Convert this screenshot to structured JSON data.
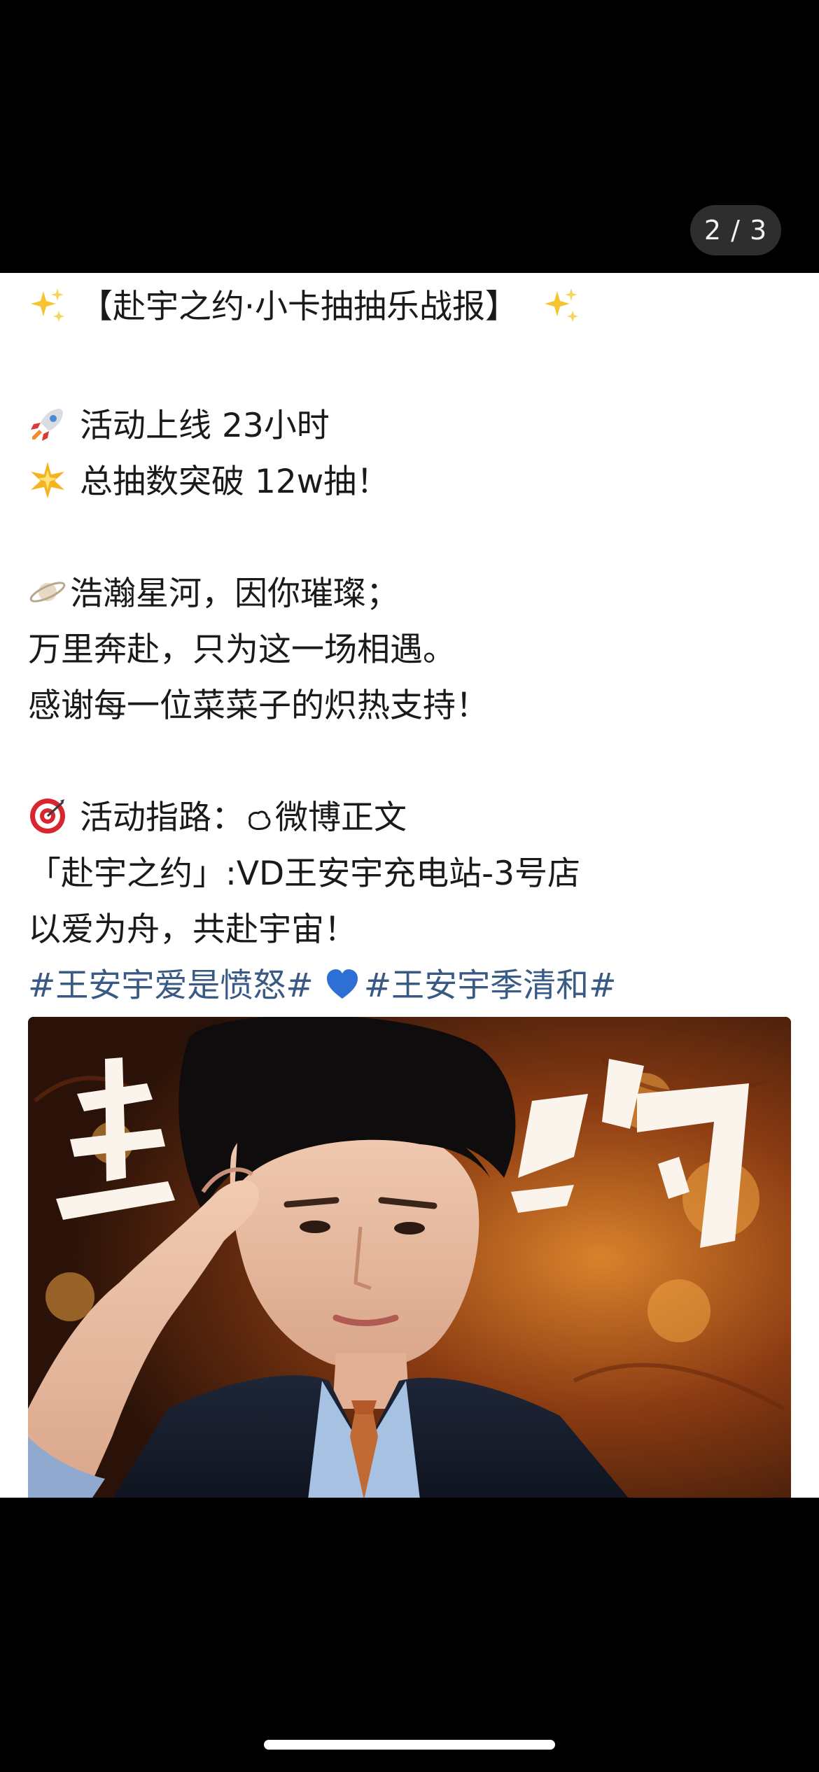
{
  "viewer": {
    "page_counter": "2 / 3"
  },
  "post": {
    "title_line": "【赴宇之约·小卡抽抽乐战报】",
    "stat_online": "活动上线 23小时",
    "stat_total": "总抽数突破  12w抽！",
    "poem_1": "浩瀚星河，因你璀璨；",
    "poem_2": "万里奔赴，只为这一场相遇。",
    "poem_3": "感谢每一位菜菜子的炽热支持！",
    "guide_prefix": "活动指路：",
    "guide_target": "微博正文",
    "store_line": "「赴宇之约」:VD王安宇充电站-3号店",
    "closing_line": "以爱为舟，共赴宇宙！",
    "hashtag_1": "#王安宇爱是愤怒#",
    "hashtag_2": "#王安宇季清和#"
  },
  "icons": {
    "sparkles": "sparkles-icon",
    "rocket": "rocket-icon",
    "glowing_star": "glowing-star-icon",
    "ringed_planet": "ringed-planet-icon",
    "target": "target-icon",
    "weibo": "weibo-icon",
    "blue_heart": "blue-heart-icon"
  },
  "colors": {
    "hashtag": "#3a5a86",
    "background": "#000000",
    "card": "#ffffff"
  }
}
